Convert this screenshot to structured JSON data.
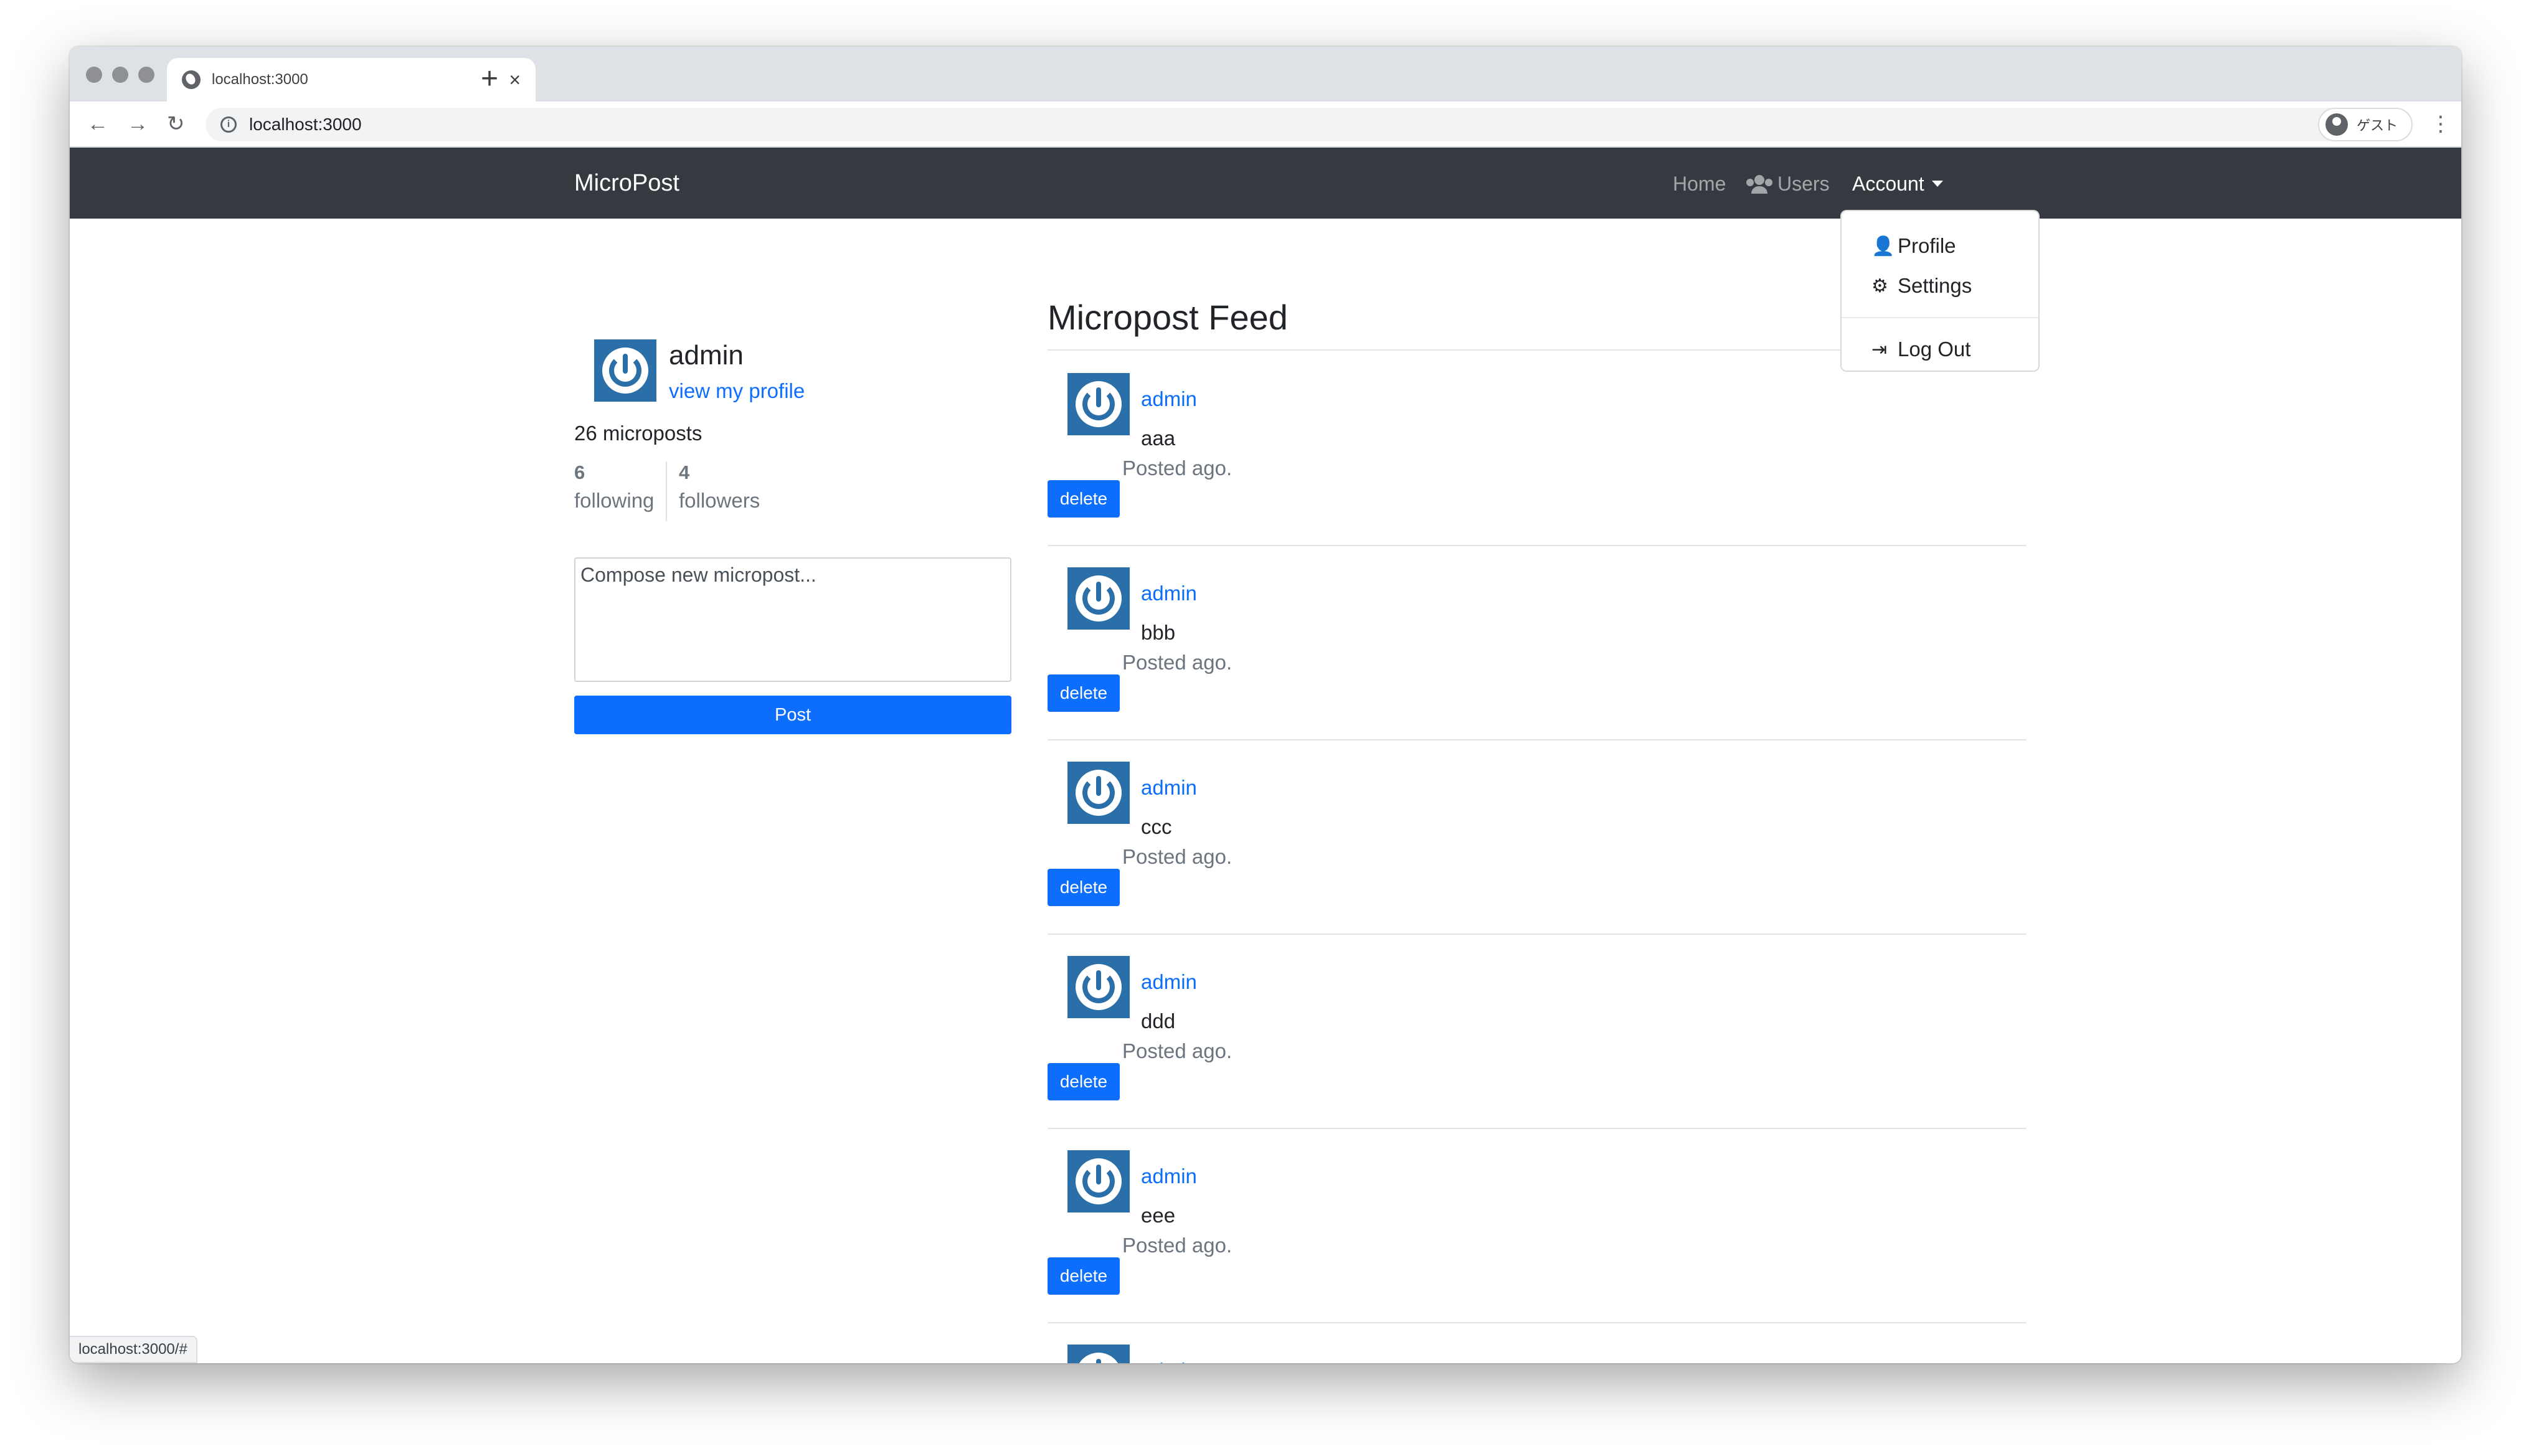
{
  "browser": {
    "tab_title": "localhost:3000",
    "url": "localhost:3000",
    "profile_label": "ゲスト",
    "status_url": "localhost:3000/#"
  },
  "navbar": {
    "brand": "MicroPost",
    "links": {
      "home": "Home",
      "users": "Users",
      "account": "Account"
    }
  },
  "account_menu": {
    "items": [
      {
        "label": "Profile",
        "icon": "user-cog-icon"
      },
      {
        "label": "Settings",
        "icon": "gear-icon"
      },
      {
        "label": "Log Out",
        "icon": "sign-out-icon"
      }
    ]
  },
  "sidebar": {
    "user_name": "admin",
    "profile_link": "view my profile",
    "microposts_count": "26 microposts",
    "following": {
      "count": "6",
      "label": "following"
    },
    "followers": {
      "count": "4",
      "label": "followers"
    },
    "compose_placeholder": "Compose new micropost...",
    "post_button": "Post"
  },
  "feed": {
    "title": "Micropost Feed",
    "posts": [
      {
        "author": "admin",
        "body": "aaa",
        "time": "Posted ago.",
        "delete_label": "delete"
      },
      {
        "author": "admin",
        "body": "bbb",
        "time": "Posted ago.",
        "delete_label": "delete"
      },
      {
        "author": "admin",
        "body": "ccc",
        "time": "Posted ago.",
        "delete_label": "delete"
      },
      {
        "author": "admin",
        "body": "ddd",
        "time": "Posted ago.",
        "delete_label": "delete"
      },
      {
        "author": "admin",
        "body": "eee",
        "time": "Posted ago.",
        "delete_label": "delete"
      },
      {
        "author": "admin",
        "body": "",
        "time": "",
        "delete_label": ""
      }
    ]
  },
  "colors": {
    "navbar_bg": "#343a40",
    "primary": "#0d6efd",
    "avatar_bg": "#2b6fa8"
  }
}
